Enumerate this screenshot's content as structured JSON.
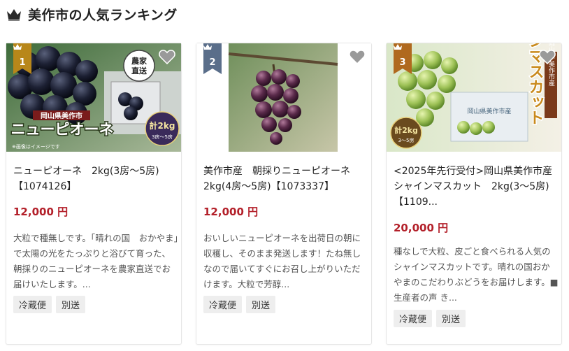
{
  "header": {
    "title": "美作市の人気ランキング",
    "icon": "crown-icon"
  },
  "colors": {
    "gold": "#b8871a",
    "slate": "#5a6e8a",
    "bronze": "#b0691e",
    "price": "#b3202a",
    "tagbg": "#eeeeee"
  },
  "cards": [
    {
      "rank": "1",
      "image": {
        "region_label": "岡山県美作市",
        "brand": "ニューピオーネ",
        "stamp_lines": [
          "農家",
          "直送"
        ],
        "seal_text": "計2kg",
        "seal_sub": "3房〜5房",
        "footnote": "※画像はイメージです"
      },
      "title": "ニューピオーネ　2kg(3房～5房)【1074126】",
      "price": "12,000 円",
      "desc": "大粒で種無しです。｢晴れの国　おかやま｣で太陽の光をたっぷりと浴びて育った、朝採りのニューピオーネを農家直送でお届けいたします。...",
      "tags": [
        "冷蔵便",
        "別送"
      ]
    },
    {
      "rank": "2",
      "title": "美作市産　朝採りニューピオーネ2kg(4房～5房)【1073337】",
      "price": "12,000 円",
      "desc": "おいしいニューピオーネを出荷日の朝に収穫し、そのまま発送します！たね無しなので届いてすぐにお召し上がりいただけます。大粒で芳醇...",
      "tags": [
        "冷蔵便",
        "別送"
      ]
    },
    {
      "rank": "3",
      "image": {
        "brand": "シャインマスカット",
        "origin_label": "岡山県 美作市産",
        "seal_text": "計2kg",
        "seal_sub": "3〜5房"
      },
      "title": "<2025年先行受付>岡山県美作市産　シャインマスカット　2kg(3～5房)【1109...",
      "price": "20,000 円",
      "desc": "種なしで大粒、皮ごと食べられる人気のシャインマスカットです。晴れの国おかやまのこだわりぶどうをお届けします。■生産者の声 き...",
      "tags": [
        "冷蔵便",
        "別送"
      ]
    }
  ]
}
